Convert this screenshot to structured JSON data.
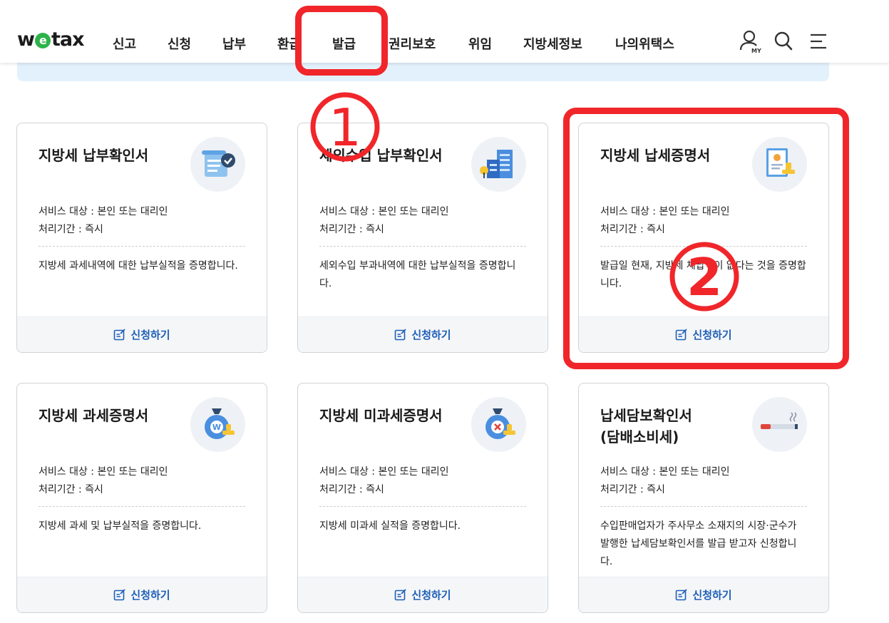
{
  "header": {
    "logo": {
      "pre": "w",
      "mid": "e",
      "post": "tax"
    },
    "nav": [
      "신고",
      "신청",
      "납부",
      "환급",
      "발급",
      "권리보호",
      "위임",
      "지방세정보",
      "나의위택스"
    ],
    "my_label": "MY"
  },
  "cards": [
    {
      "title": "지방세 납부확인서",
      "target": "서비스 대상 : 본인 또는 대리인",
      "period": "처리기간 : 즉시",
      "desc": "지방세 과세내역에 대한 납부실적을 증명합니다.",
      "button": "신청하기",
      "icon": "scroll-check-icon"
    },
    {
      "title": "세외수입 납부확인서",
      "target": "서비스 대상 : 본인 또는 대리인",
      "period": "처리기간 : 즉시",
      "desc": "세외수입 부과내역에 대한 납부실적을 증명합니다.",
      "button": "신청하기",
      "icon": "buildings-icon"
    },
    {
      "title": "지방세 납세증명서",
      "target": "서비스 대상 : 본인 또는 대리인",
      "period": "처리기간 : 즉시",
      "desc": "발급일 현재, 지방세 체납액이 없다는 것을 증명합니다.",
      "button": "신청하기",
      "icon": "certificate-stamp-icon"
    },
    {
      "title": "지방세 과세증명서",
      "target": "서비스 대상 : 본인 또는 대리인",
      "period": "처리기간 : 즉시",
      "desc": "지방세 과세 및 납부실적을 증명합니다.",
      "button": "신청하기",
      "icon": "money-bag-stamp-icon"
    },
    {
      "title": "지방세 미과세증명서",
      "target": "서비스 대상 : 본인 또는 대리인",
      "period": "처리기간 : 즉시",
      "desc": "지방세 미과세 실적을 증명합니다.",
      "button": "신청하기",
      "icon": "money-bag-x-stamp-icon"
    },
    {
      "title": "납세담보확인서\n(담배소비세)",
      "target": "서비스 대상 : 본인 또는 대리인",
      "period": "처리기간 : 즉시",
      "desc": "수입판매업자가 주사무소 소재지의 시장·군수가 발행한 납세담보확인서를 발급 받고자 신청합니다.",
      "button": "신청하기",
      "icon": "cigarette-icon"
    }
  ],
  "annotations": {
    "step1": "1",
    "step2": "2"
  },
  "colors": {
    "accent_red": "#f0262a",
    "link_blue": "#1d5fb8",
    "notice_bg": "#e3f1fc"
  }
}
